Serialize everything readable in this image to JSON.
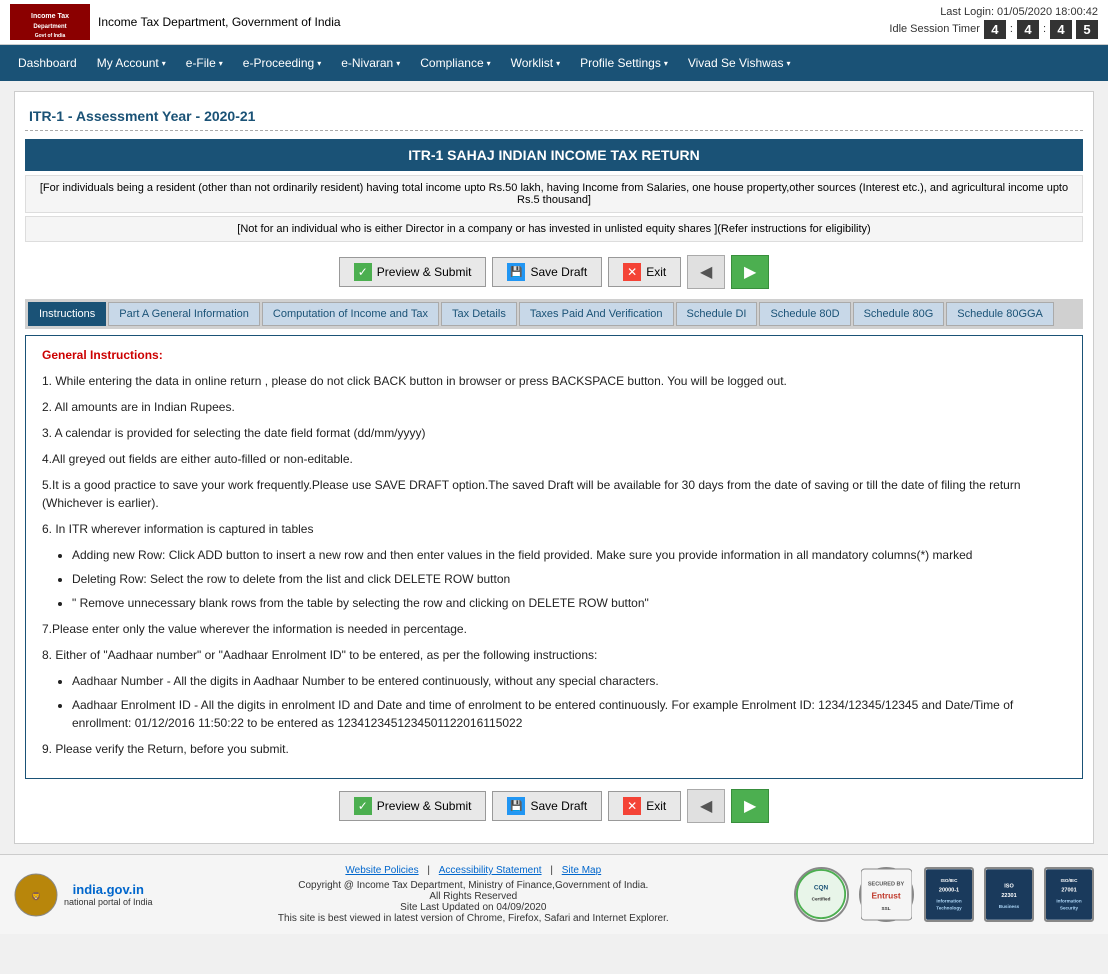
{
  "header": {
    "logo_text": "Income Tax Department, Government of India",
    "last_login": "Last Login: 01/05/2020 18:00:42",
    "session_timer_label": "Idle Session Timer",
    "timer_digits": [
      "4",
      "4",
      "4",
      "5"
    ]
  },
  "nav": {
    "items": [
      {
        "label": "Dashboard",
        "has_arrow": false
      },
      {
        "label": "My Account",
        "has_arrow": true
      },
      {
        "label": "e-File",
        "has_arrow": true
      },
      {
        "label": "e-Proceeding",
        "has_arrow": true
      },
      {
        "label": "e-Nivaran",
        "has_arrow": true
      },
      {
        "label": "Compliance",
        "has_arrow": true
      },
      {
        "label": "Worklist",
        "has_arrow": true
      },
      {
        "label": "Profile Settings",
        "has_arrow": true
      },
      {
        "label": "Vivad Se Vishwas",
        "has_arrow": true
      }
    ]
  },
  "page_title": "ITR-1 - Assessment Year - 2020-21",
  "form_header": "ITR-1 SAHAJ INDIAN INCOME TAX RETURN",
  "notice1": "[For individuals being a resident (other than not ordinarily resident) having total income upto Rs.50 lakh, having Income from Salaries, one house property,other sources (Interest etc.), and agricultural income upto Rs.5 thousand]",
  "notice2": "[Not for an individual who is either Director in a company or has invested in unlisted equity shares ](Refer instructions for eligibility)",
  "buttons": {
    "preview_submit": "Preview & Submit",
    "save_draft": "Save Draft",
    "exit": "Exit"
  },
  "tabs": [
    {
      "label": "Instructions",
      "active": true
    },
    {
      "label": "Part A General Information",
      "active": false
    },
    {
      "label": "Computation of Income and Tax",
      "active": false
    },
    {
      "label": "Tax Details",
      "active": false
    },
    {
      "label": "Taxes Paid And Verification",
      "active": false
    },
    {
      "label": "Schedule DI",
      "active": false
    },
    {
      "label": "Schedule 80D",
      "active": false
    },
    {
      "label": "Schedule 80G",
      "active": false
    },
    {
      "label": "Schedule 80GGA",
      "active": false
    }
  ],
  "instructions": {
    "heading": "General Instructions:",
    "items": [
      "1. While entering the data in online return , please do not click BACK button in browser or press BACKSPACE button. You will be logged out.",
      "2. All amounts are in Indian Rupees.",
      "3. A calendar is provided for selecting the date field format (dd/mm/yyyy)",
      "4.All greyed out fields are either auto-filled or non-editable.",
      "5.It is a good practice to save your work frequently.Please use SAVE DRAFT option.The saved Draft will be available for 30 days from the date of saving or till the date of filing the return (Whichever is earlier).",
      "6. In ITR wherever information is captured in tables"
    ],
    "sub_items": [
      "Adding new Row: Click ADD button to insert a new row and then enter values in the field provided. Make sure you provide information in all mandatory columns(*) marked",
      "Deleting Row: Select the row to delete from the list and click DELETE ROW button",
      "\" Remove unnecessary blank rows from the table by selecting the row and clicking on DELETE ROW button\""
    ],
    "items_continued": [
      "7.Please enter only the value wherever the information is needed in percentage.",
      "8. Either of \"Aadhaar number\" or \"Aadhaar Enrolment ID\" to be entered, as per the following instructions:"
    ],
    "aadhar_sub_items": [
      "Aadhaar Number - All the digits in Aadhaar Number to be entered continuously, without any special characters.",
      "Aadhaar Enrolment ID - All the digits in enrolment ID and Date and time of enrolment to be entered continuously. For example Enrolment ID: 1234/12345/12345 and Date/Time of enrollment: 01/12/2016 11:50:22 to be entered as 1234123451234501122016115022"
    ],
    "last_item": "9. Please verify the Return, before you submit."
  },
  "footer": {
    "website_policies": "Website Policies",
    "accessibility": "Accessibility Statement",
    "site_map": "Site Map",
    "copyright": "Copyright @ Income Tax Department, Ministry of Finance,Government of India.",
    "rights": "All Rights Reserved",
    "last_updated": "Site Last Updated on 04/09/2020",
    "best_viewed": "This site is best viewed in latest version of Chrome, Firefox, Safari and Internet Explorer.",
    "cqn_label": "CQN",
    "entrust_label": "SECURED BY\nEntrust",
    "bsi_labels": [
      "ISO/IEC\n20000-1",
      "ISO\n22301",
      "ISO/IEC\n27001"
    ]
  }
}
